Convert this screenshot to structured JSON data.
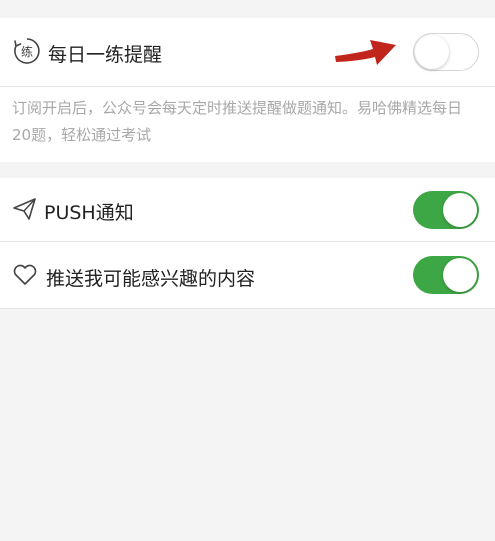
{
  "daily_practice": {
    "label": "每日一练提醒",
    "icon": "练",
    "enabled": false,
    "description": "订阅开启后，公众号会每天定时推送提醒做题通知。易哈佛精选每日20题，轻松通过考试"
  },
  "push_notification": {
    "label": "PUSH通知",
    "enabled": true
  },
  "interest_push": {
    "label": "推送我可能感兴趣的内容",
    "enabled": true
  },
  "colors": {
    "toggle_on": "#3ea745",
    "annotation_arrow": "#c0261c"
  }
}
